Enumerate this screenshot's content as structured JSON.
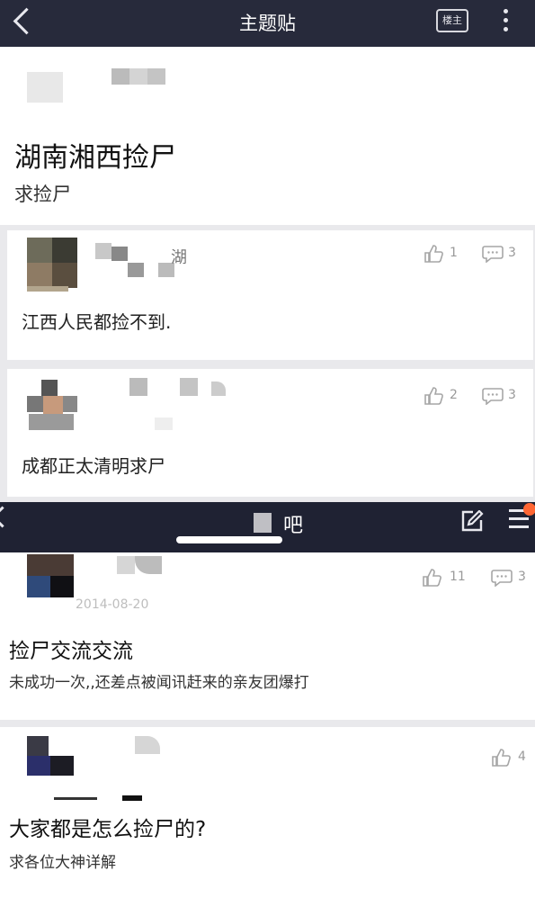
{
  "topbar": {
    "title": "主题贴",
    "owner_label": "楼主"
  },
  "post": {
    "title": "湖南湘西捡尸",
    "body": "求捡尸"
  },
  "replies": [
    {
      "text": "江西人民都捡不到.",
      "likes": "1",
      "comments": "3",
      "name_suffix": "湖"
    },
    {
      "text": "成都正太清明求尸",
      "likes": "2",
      "comments": "3"
    }
  ],
  "bar2": {
    "title": "吧"
  },
  "tieba_posts": [
    {
      "title": "捡尸交流交流",
      "body": "未成功一次,,还差点被闻讯赶来的亲友团爆打",
      "likes": "11",
      "comments": "3",
      "date": "2014-08-20"
    },
    {
      "title": "大家都是怎么捡尸的?",
      "body": "求各位大神详解",
      "likes": "4"
    }
  ],
  "icons": {
    "back": "chevron-left-icon",
    "more": "more-dots-icon",
    "like": "thumbs-up-icon",
    "comment": "comment-bubble-icon",
    "edit": "edit-icon",
    "menu": "menu-icon"
  },
  "colors": {
    "header_bg": "#272a3b",
    "accent_badge": "#ff6633"
  }
}
